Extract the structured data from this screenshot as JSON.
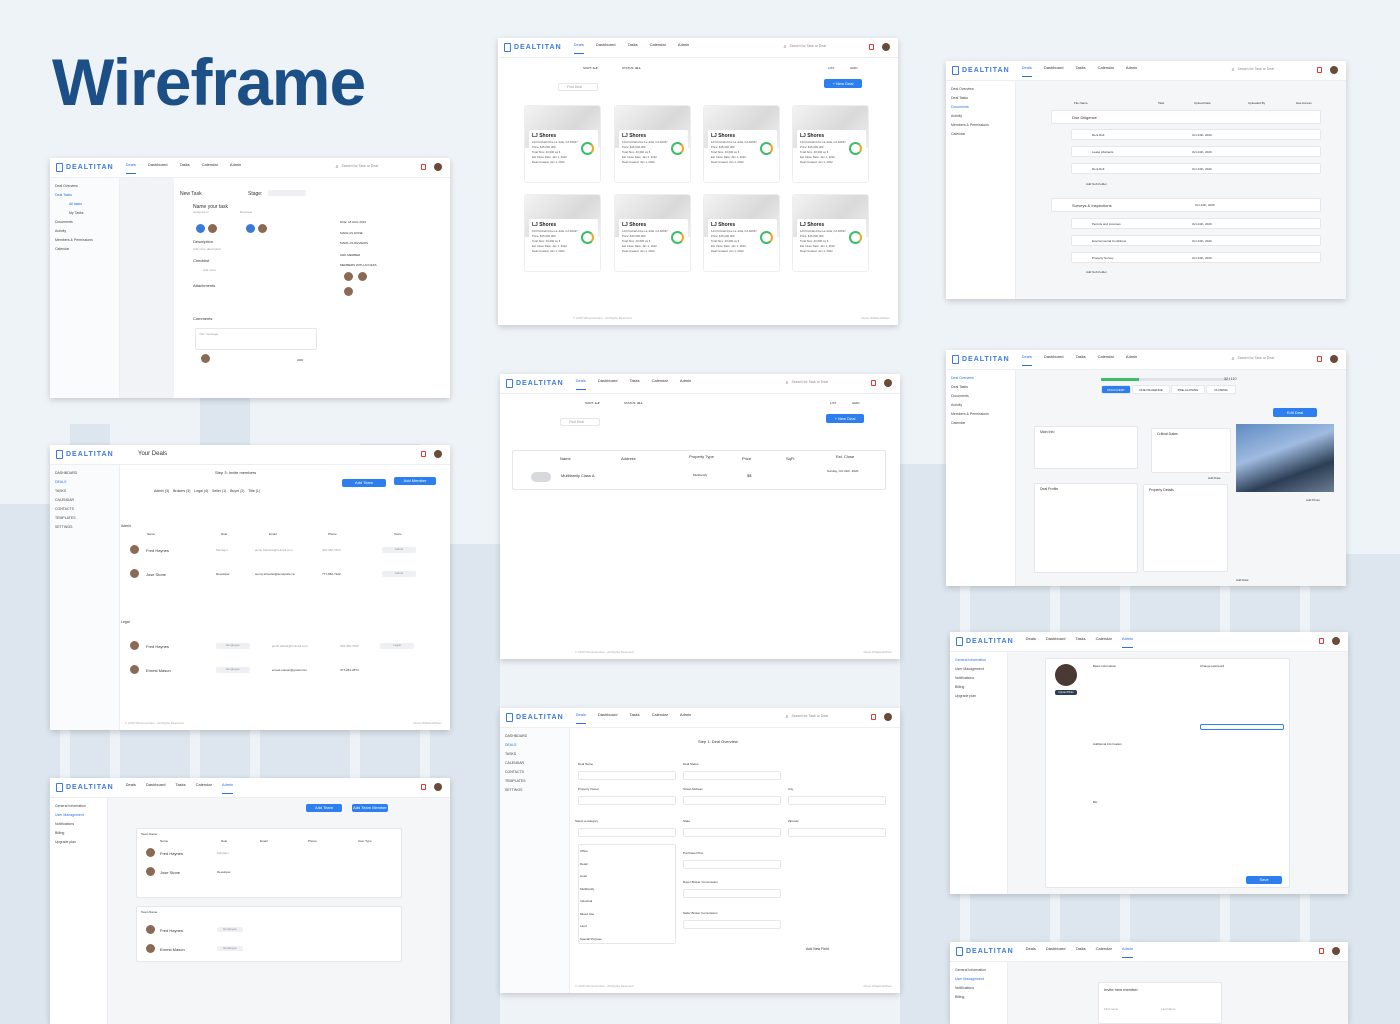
{
  "hero": {
    "title": "Wireframe"
  },
  "brand": "DEALTITAN",
  "nav": [
    "Deals",
    "Dashboard",
    "Tasks",
    "Calendar",
    "Admin"
  ],
  "search": "Search for Task or Deal",
  "sidebar": [
    "Deal Overview",
    "Deal Tasks",
    "All tasks",
    "My Tasks",
    "Documents",
    "Activity",
    "Members & Permissions",
    "Calendar"
  ],
  "task": {
    "title": "New Task",
    "stage_label": "Stage:",
    "name": "Name your task",
    "assigned": "Assigned to",
    "reviewer": "Reviewer",
    "description": "Description",
    "desc_ph": "Add more description",
    "checklist": "Checklist",
    "add_more": "Add more",
    "attachments": "Attachments",
    "comments": "Comments",
    "your_msg": "Your message",
    "add": "ADD",
    "due": "DUE: 18 AUG 2019",
    "make_done": "MAKE AS DONE",
    "mark_review": "MARK AS REVIEWS",
    "add_member": "ADD MEMBER",
    "members_access": "MEMBERS WITH ACCESS"
  },
  "toolbar": {
    "sort": "SORT:",
    "sort_val": "A-Z",
    "status": "STATUS:",
    "status_val": "ALL",
    "list": "LIST",
    "grid": "GRID",
    "find": "Find Deal",
    "new_deal": "+ New Deal"
  },
  "cards": [
    {
      "title": "LJ Shores",
      "addr": "123 Kimball drive La Jolla, CA 92037"
    },
    {
      "title": "LJ Shores",
      "addr": "123 Kimball drive La Jolla, CA 92037"
    },
    {
      "title": "LJ Shores",
      "addr": "123 Kimball drive La Jolla, CA 92037"
    },
    {
      "title": "LJ Shores",
      "addr": "123 Kimball drive La Jolla, CA 92037"
    },
    {
      "title": "LJ Shores",
      "addr": "123 Kimball drive La Jolla, CA 92037"
    },
    {
      "title": "LJ Shores",
      "addr": "123 Kimball drive La Jolla, CA 92037"
    },
    {
      "title": "LJ Shores",
      "addr": "123 Kimball drive La Jolla, CA 92037"
    },
    {
      "title": "LJ Shores",
      "addr": "123 Kimball drive La Jolla, CA 92037"
    }
  ],
  "card_fields": [
    "Price: $15,000,000",
    "Total Size: 40,000 sq ft",
    "Est Close Date: Jan 1, 2022",
    "Deal Created: Jan 1, 2022"
  ],
  "footer": "© 2019 Whoeverwhen - All Rights Reserved",
  "footer_r": "About WhatsUsWhen",
  "docs": {
    "cols": [
      "File Name",
      "Task",
      "Upload Date",
      "Uploaded By",
      "Has Access"
    ],
    "sections": [
      {
        "name": "Due Diligence",
        "files": [
          "Rent Roll",
          "Lease Abstracts",
          "Rent Roll"
        ]
      },
      {
        "name": "Surveys & Inspections",
        "files": [
          "Permits and Licenses",
          "Environmental Conditions",
          "Property Survey"
        ]
      }
    ],
    "date": "Oct 24th, 2020",
    "add_folder": "Add Sub Folder"
  },
  "yourdeals": {
    "title": "Your Deals",
    "step": "Step 3: Invite members",
    "add_team": "Add Team",
    "add_member": "Add Member",
    "tabs": [
      "Admin (3)",
      "Brokers (3)",
      "Legal (4)",
      "Seller (1)",
      "Buyer (2)",
      "Title (1)"
    ],
    "sections": [
      "Admin",
      "Legal"
    ],
    "cols": [
      "Name",
      "Role",
      "Email",
      "Phone",
      "Team"
    ],
    "rows": [
      [
        "Fred Haynes",
        "Manager",
        "jamie.barbara@hotmail.com",
        "305-456-7603",
        "Admin"
      ],
      [
        "Jose Stone",
        "Developer",
        "sunny.shoocks@annapolis.ca",
        "777-962-7222",
        "Admin"
      ],
      [
        "Fred Haynes",
        "Employee",
        "jacob.abbatt@hotmail.com",
        "305-456-7603",
        "Legal"
      ],
      [
        "Ernest Mason",
        "Employee",
        "ernest.mason@gmail.com",
        "477-281-2874",
        ""
      ]
    ]
  },
  "listview": {
    "cols": [
      "Name",
      "Address",
      "Property Type",
      "Price",
      "SqFt",
      "Est. Close"
    ],
    "row": [
      "Multifamily Class A",
      "",
      "Multifamily",
      "$$",
      "",
      "Sunday, Oct 24th, 2020"
    ]
  },
  "overview": {
    "stages": [
      "DISCOVERY",
      "DUE DILIGENCE",
      "PRE-CLOSING",
      "CLOSING"
    ],
    "progress": "32 / 110",
    "edit": "Edit Deal",
    "main": "Main Info",
    "critical": "Critical Dates",
    "profile": "Deal Profile",
    "details": "Property Details",
    "add_date": "Add Date",
    "add_photo": "Add Photo"
  },
  "admin": {
    "tabs": [
      "General Information",
      "User Management",
      "Notifications",
      "Billing",
      "Upgrade plan"
    ],
    "basic": "Basic Information",
    "change_pw": "Change password",
    "additional": "Additional information",
    "bio": "Bio",
    "save": "Save",
    "upload": "Upload Photo"
  },
  "step1": {
    "title": "Step 1: Deal Overview",
    "fields": [
      "Deal Name",
      "Deal Status",
      "Property Owner",
      "Street Address",
      "City",
      "Select a category",
      "State",
      "Zipcode",
      "Purchase Price",
      "Buyer Broker Commission",
      "Seller Broker Commission"
    ],
    "types": [
      "Office",
      "Retail",
      "Hotel",
      "Multifamily",
      "Industrial",
      "Mixed Use",
      "Land",
      "Special Purpose"
    ],
    "add_field": "Add New Field"
  },
  "users": {
    "add_team": "Add Team",
    "add_member": "Add Team Member",
    "team": "Team Name",
    "cols": [
      "Name",
      "Role",
      "Email",
      "Phone",
      "User Type"
    ],
    "rows": [
      [
        "Fred Haynes",
        "Manager"
      ],
      [
        "Jose Stone",
        "Developer"
      ],
      [
        "Fred Haynes",
        "Employee"
      ],
      [
        "Ernest Mason",
        "Employee"
      ]
    ]
  },
  "invite": {
    "title": "Invite new member",
    "first": "First name",
    "last": "Last Name"
  }
}
